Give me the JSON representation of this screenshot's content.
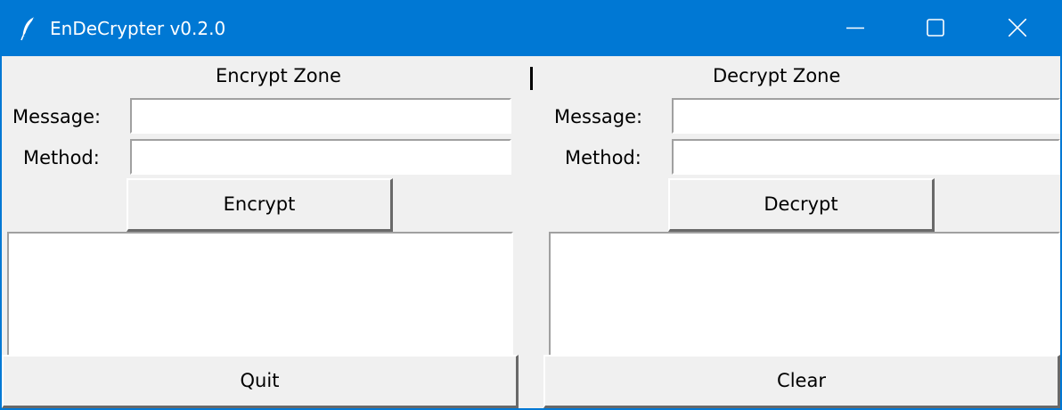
{
  "window": {
    "title": "EnDeCrypter v0.2.0",
    "app_icon": "feather-icon",
    "titlebar_color": "#0078d4",
    "controls": [
      "minimize-icon",
      "maximize-icon",
      "close-icon"
    ]
  },
  "encrypt_zone": {
    "heading": "Encrypt Zone",
    "message_label": "Message:",
    "message_value": "",
    "method_label": "Method:",
    "method_value": "",
    "action_label": "Encrypt",
    "output_text": ""
  },
  "decrypt_zone": {
    "heading": "Decrypt Zone",
    "message_label": "Message:",
    "message_value": "",
    "method_label": "Method:",
    "method_value": "",
    "action_label": "Decrypt",
    "output_text": ""
  },
  "separator_text": "|",
  "footer": {
    "quit_label": "Quit",
    "clear_label": "Clear"
  }
}
